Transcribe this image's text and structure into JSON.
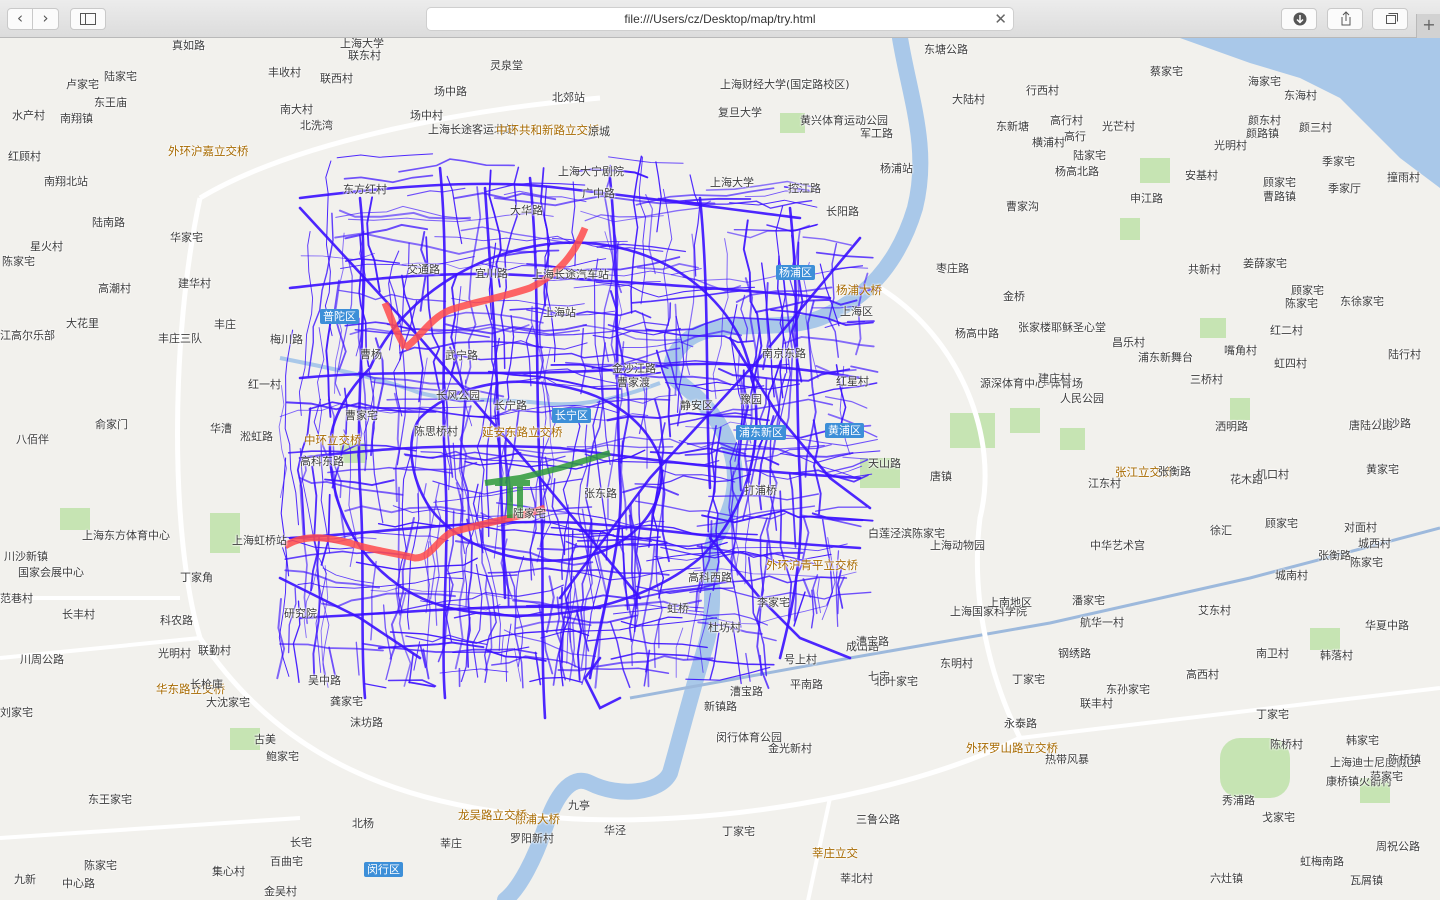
{
  "browser": {
    "url": "file:///Users/cz/Desktop/map/try.html",
    "back": "‹",
    "forward": "›",
    "close": "✕",
    "new_tab": "+",
    "icons": [
      "chevron-left-icon",
      "chevron-right-icon",
      "sidebar-icon",
      "download-icon",
      "share-icon",
      "tabs-icon",
      "plus-icon"
    ]
  },
  "map": {
    "colors": {
      "land": "#f2f1ed",
      "water": "#a9c8e9",
      "green": "#c6e4b3",
      "trace": "#3a10ff",
      "highlight_red": "#ff4b4b",
      "highlight_green": "#2e9a3a",
      "rail": "#9db9dc",
      "highway": "#ffffff"
    },
    "district_badges": [
      "普陀区",
      "杨浦区",
      "长宁区",
      "黄浦区",
      "浦东新区",
      "闵行区"
    ],
    "labels": [
      "上海大学",
      "联东村",
      "真如路",
      "卢家宅",
      "陆家宅",
      "丰收村",
      "灵泉堂",
      "上海财经大学(国定路校区)",
      "东塘公路",
      "蔡家宅",
      "海家宅",
      "东王庙",
      "联西村",
      "场中路",
      "北郊站",
      "大陆村",
      "行西村",
      "东海村",
      "水产村",
      "南翔镇",
      "南大村",
      "北洗湾",
      "场中村",
      "复旦大学",
      "黄兴体育运动公园",
      "高行村",
      "光芒村",
      "颜东村",
      "颜三村",
      "外环沪嘉立交桥",
      "上海长途客运北站",
      "中环共和新路立交桥",
      "凉城",
      "东新塘",
      "横浦村",
      "高行",
      "陆家宅",
      "颜路镇",
      "光明村",
      "红顾村",
      "南翔北站",
      "东方红村",
      "上海大宁剧院",
      "上海大学",
      "控江路",
      "杨浦站",
      "杨高北路",
      "季家宅",
      "安基村",
      "撞雨村",
      "陆南路",
      "广中路",
      "军工路",
      "申江路",
      "曹家沟",
      "顾家宅",
      "曹路镇",
      "季家厅",
      "星火村",
      "华家宅",
      "大华路",
      "长阳路",
      "陈家宅",
      "交通路",
      "宜川路",
      "上海长途汽车站",
      "共新村",
      "姜薛家宅",
      "高潮村",
      "建华村",
      "杨浦大桥",
      "枣庄路",
      "金桥",
      "顾家宅",
      "陈家宅",
      "东徐家宅",
      "大花里",
      "丰庄",
      "普陀区",
      "杨浦区",
      "上海区",
      "张家楼耶稣圣心堂",
      "杨高中路",
      "红二村",
      "江高尔乐部",
      "丰庄三队",
      "梅川路",
      "曹杨",
      "武宁路",
      "上海站",
      "昌乐村",
      "嘴角村",
      "虹四村",
      "红一村",
      "金沙江路",
      "南京东路",
      "浦东新舞台",
      "陆行村",
      "红星村",
      "源深体育中心-体育场",
      "建庄村",
      "三桥村",
      "曹家宅",
      "长风公园",
      "曹家渡",
      "人民公园",
      "俞家门",
      "华漕",
      "淞虹路",
      "中环立交桥",
      "长宁路",
      "静安区",
      "豫园",
      "八佰伴",
      "陈思桥村",
      "长宁区",
      "延安东路立交桥",
      "黄浦区",
      "浦东新区",
      "洒明路",
      "唐陆公路",
      "川沙路",
      "高科东路",
      "天山路",
      "花木路",
      "唐镇",
      "机口村",
      "黄家宅",
      "张江立交桥",
      "江东村",
      "张衡路",
      "张东路",
      "打浦桥",
      "上海东方体育中心",
      "上海虹桥站",
      "上海动物园",
      "白莲泾滨陈家宅",
      "陆家宅",
      "徐汇",
      "顾家宅",
      "对面村",
      "城西村",
      "川沙新镇",
      "国家会展中心",
      "丁家角",
      "外环沪青平立交桥",
      "高科西路",
      "中华艺术宫",
      "张衡路",
      "陈家宅",
      "城南村",
      "长丰村",
      "研究院",
      "范巷村",
      "虹桥",
      "上海国家科学院",
      "上南地区",
      "李家宅",
      "潘家宅",
      "艾东村",
      "华夏中路",
      "科农路",
      "杜坊村",
      "航华一村",
      "成山路",
      "光明村",
      "联勤村",
      "吴中路",
      "号上村",
      "漕宝路",
      "东明村",
      "钢绣路",
      "南卫村",
      "韩落村",
      "川周公路",
      "华东路立交桥",
      "长枪庫",
      "七宝",
      "漕宝路",
      "北叶家宅",
      "丁家宅",
      "东孙家宅",
      "高西村",
      "龚家宅",
      "平南路",
      "大沈家宅",
      "新镇路",
      "联丰村",
      "刘家宅",
      "沫坊路",
      "古美",
      "闵行体育公园",
      "金光新村",
      "永泰路",
      "外环罗山路立交桥",
      "丁家宅",
      "韩家宅",
      "陈桥村",
      "上海迪士尼度假区",
      "陈桥镇",
      "鲍家宅",
      "热带风暴",
      "康桥镇火箭村",
      "范家宅",
      "东王家宅",
      "九亭",
      "徐浦大桥",
      "龙吴路立交桥",
      "北杨",
      "罗阳新村",
      "华泾",
      "丁家宅",
      "三鲁公路",
      "秀浦路",
      "戈家宅",
      "长宅",
      "莘庄立交",
      "百曲宅",
      "闵行区",
      "集心村",
      "莘北村",
      "陈家宅",
      "中心路",
      "九新",
      "金吴村",
      "莘庄",
      "虹梅南路",
      "周祝公路",
      "六灶镇",
      "瓦屑镇",
      "戴家宅"
    ]
  }
}
